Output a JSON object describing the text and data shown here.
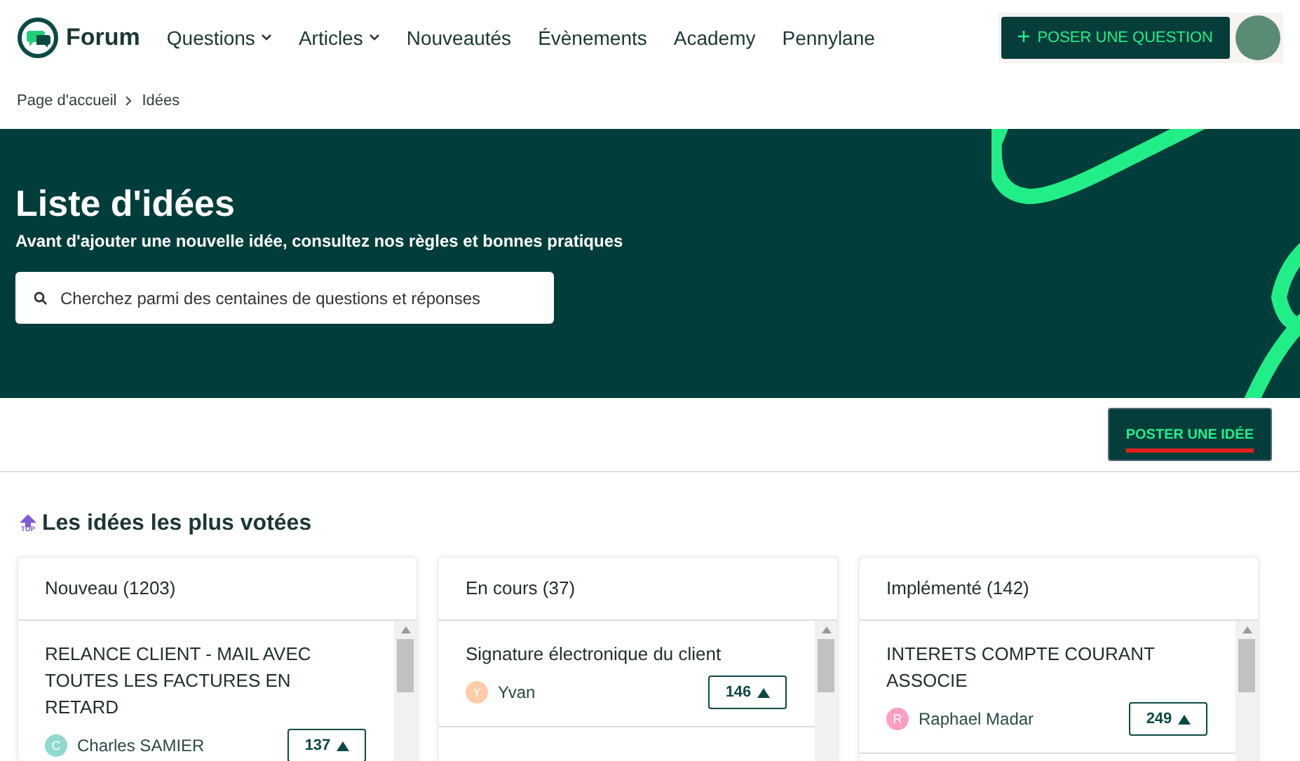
{
  "header": {
    "brand": "Forum",
    "nav": [
      {
        "label": "Questions",
        "dropdown": true
      },
      {
        "label": "Articles",
        "dropdown": true
      },
      {
        "label": "Nouveautés",
        "dropdown": false
      },
      {
        "label": "Évènements",
        "dropdown": false
      },
      {
        "label": "Academy",
        "dropdown": false
      },
      {
        "label": "Pennylane",
        "dropdown": false
      }
    ],
    "ask_button": "POSER UNE QUESTION"
  },
  "breadcrumb": [
    "Page d'accueil",
    "Idées"
  ],
  "hero": {
    "title": "Liste d'idées",
    "subtitle": "Avant d'ajouter une nouvelle idée, consultez nos règles et bonnes pratiques",
    "search": {
      "placeholder": "Cherchez parmi des centaines de questions et réponses"
    }
  },
  "post_button": "POSTER UNE IDÉE",
  "section_title": "Les idées les plus votées",
  "top_badge": "TOP",
  "columns": [
    {
      "title": "Nouveau (1203)",
      "ideas": [
        {
          "title": "RELANCE CLIENT - MAIL AVEC TOUTES LES FACTURES EN RETARD",
          "initial": "C",
          "author": "Charles SAMIER",
          "color": "#8fd9cf",
          "votes": "137"
        }
      ]
    },
    {
      "title": "En cours (37)",
      "ideas": [
        {
          "title": "Signature électronique du client",
          "initial": "Y",
          "author": "Yvan",
          "color": "#ffcba8",
          "votes": "146"
        }
      ]
    },
    {
      "title": "Implémenté (142)",
      "ideas": [
        {
          "title": "INTERETS COMPTE COURANT ASSOCIE",
          "initial": "R",
          "author": "Raphael Madar",
          "color": "#ff9ec0",
          "votes": "249"
        }
      ]
    }
  ]
}
